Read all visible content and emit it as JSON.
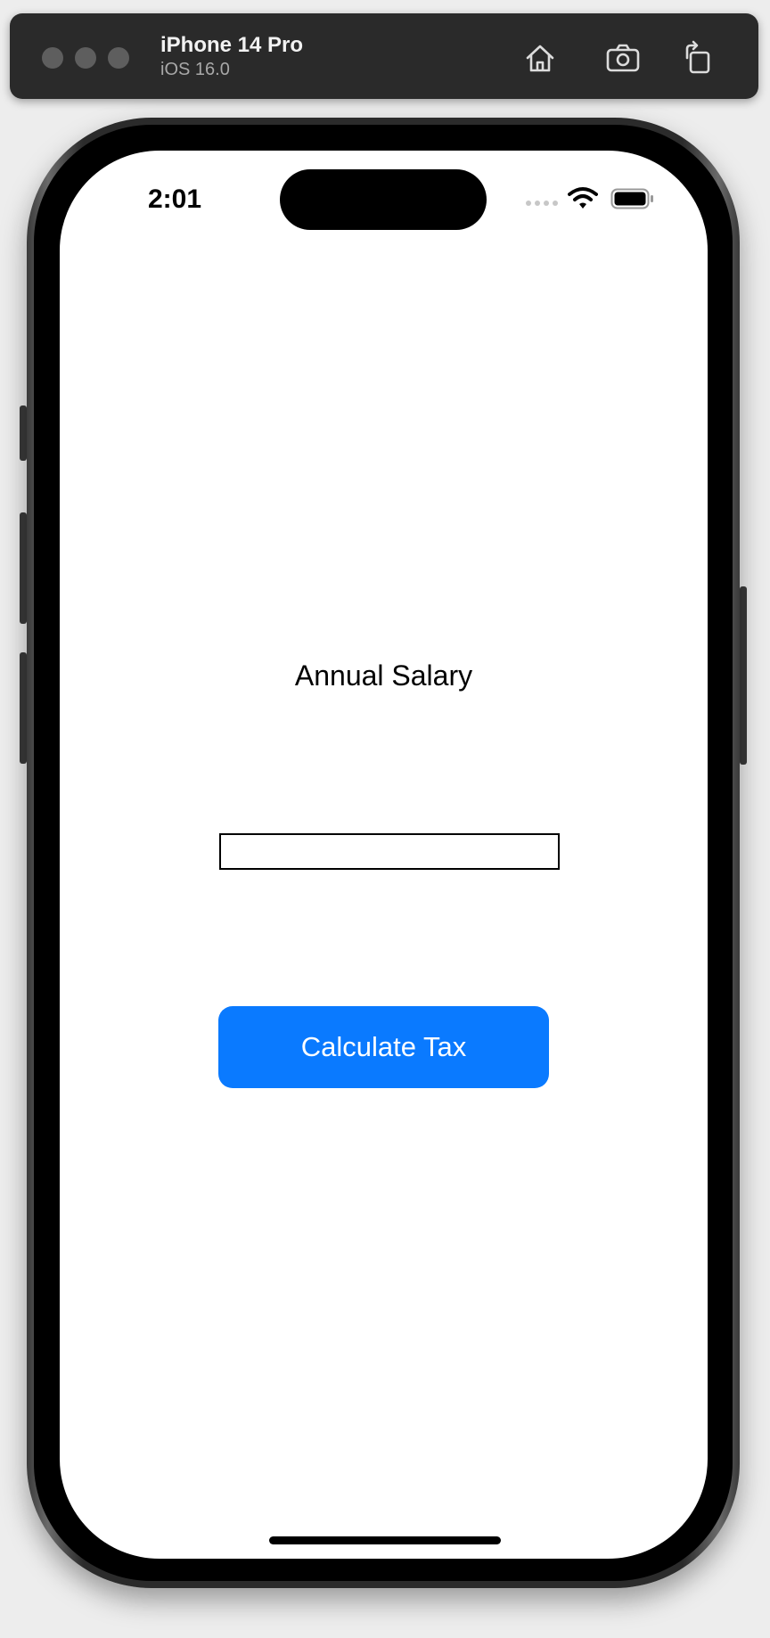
{
  "simulator": {
    "device_name": "iPhone 14 Pro",
    "os_version": "iOS 16.0",
    "toolbar_icons": [
      "home-icon",
      "screenshot-icon",
      "rotate-icon"
    ]
  },
  "status_bar": {
    "time": "2:01",
    "icons": [
      "signal-dots-icon",
      "wifi-icon",
      "battery-icon"
    ]
  },
  "app": {
    "salary_label": "Annual Salary",
    "salary_input": {
      "value": "",
      "placeholder": ""
    },
    "calculate_button": "Calculate Tax"
  },
  "colors": {
    "accent": "#0a7aff",
    "toolbar_bg": "#2a2a2a",
    "screen_bg": "#ffffff"
  }
}
